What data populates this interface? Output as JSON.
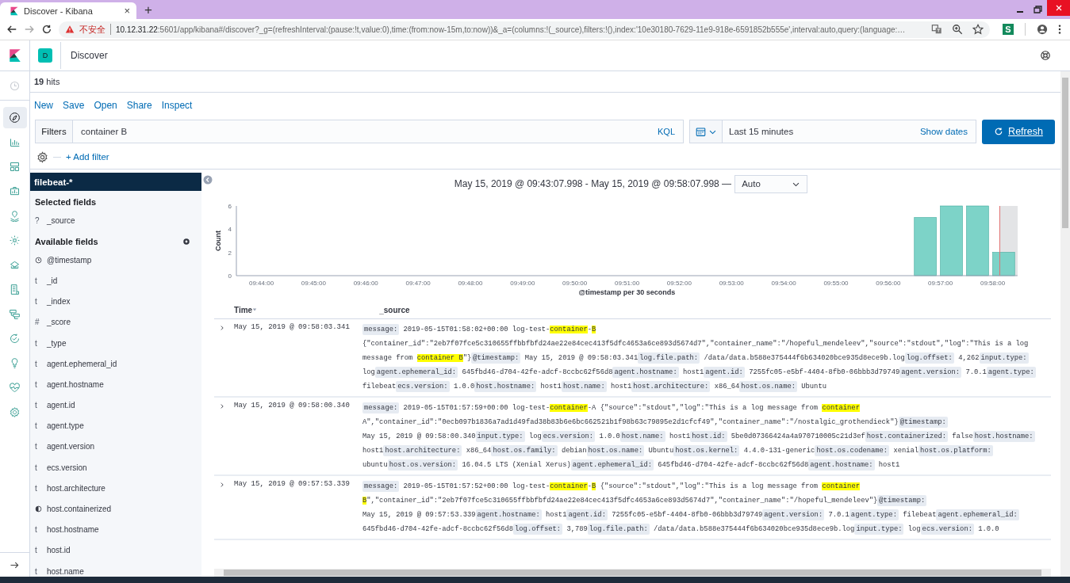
{
  "browser": {
    "tab_title": "Discover - Kibana",
    "tab_close": "×",
    "new_tab": "+",
    "security_label": "不安全",
    "url_host": "10.12.31.22",
    "url_rest": ":5601/app/kibana#/discover?_g=(refreshInterval:(pause:!t,value:0),time:(from:now-15m,to:now))&_a=(columns:!(_source),filters:!(),index:'10e30180-7629-11e9-918e-6591852b555e',interval:auto,query:(language:…",
    "extension_label": "S"
  },
  "header": {
    "space": "D",
    "breadcrumb": "Discover"
  },
  "nav_items": [
    {
      "selected": true
    },
    {
      "selected": false
    },
    {
      "selected": false
    },
    {
      "selected": false
    },
    {
      "selected": false
    },
    {
      "selected": false
    },
    {
      "selected": false
    },
    {
      "selected": false
    },
    {
      "selected": false
    },
    {
      "selected": false
    },
    {
      "selected": false
    },
    {
      "selected": false
    },
    {
      "selected": false
    }
  ],
  "hits": "**19** hits",
  "menu": [
    "New",
    "Save",
    "Open",
    "Share",
    "Inspect"
  ],
  "query": {
    "label": "Filters",
    "value": "container B",
    "language": "KQL",
    "time_range": "Last 15 minutes",
    "show_dates": "Show dates",
    "refresh": "Refresh",
    "add_filter": "+ Add filter"
  },
  "sidebar": {
    "index": "filebeat-*",
    "selected_title": "Selected fields",
    "selected": [
      {
        "kind": "unknown",
        "type_label": "?",
        "name": "_source"
      }
    ],
    "available_title": "Available fields",
    "available": [
      {
        "kind": "date",
        "name": "@timestamp"
      },
      {
        "kind": "text",
        "type_label": "t",
        "name": "_id"
      },
      {
        "kind": "text",
        "type_label": "t",
        "name": "_index"
      },
      {
        "kind": "text",
        "type_label": "#",
        "name": "_score"
      },
      {
        "kind": "text",
        "type_label": "t",
        "name": "_type"
      },
      {
        "kind": "text",
        "type_label": "t",
        "name": "agent.ephemeral_id"
      },
      {
        "kind": "text",
        "type_label": "t",
        "name": "agent.hostname"
      },
      {
        "kind": "text",
        "type_label": "t",
        "name": "agent.id"
      },
      {
        "kind": "text",
        "type_label": "t",
        "name": "agent.type"
      },
      {
        "kind": "text",
        "type_label": "t",
        "name": "agent.version"
      },
      {
        "kind": "text",
        "type_label": "t",
        "name": "ecs.version"
      },
      {
        "kind": "text",
        "type_label": "t",
        "name": "host.architecture"
      },
      {
        "kind": "boolean",
        "name": "host.containerized"
      },
      {
        "kind": "text",
        "type_label": "t",
        "name": "host.hostname"
      },
      {
        "kind": "text",
        "type_label": "t",
        "name": "host.id"
      },
      {
        "kind": "text",
        "type_label": "t",
        "name": "host.name"
      }
    ]
  },
  "chart": {
    "range": "May 15, 2019 @ 09:43:07.998 - May 15, 2019 @ 09:58:07.998 —",
    "interval": "Auto",
    "chart_data": {
      "type": "bar",
      "xlabel": "@timestamp per 30 seconds",
      "ylabel": "Count",
      "categories": [
        null,
        null,
        "09:44:00",
        null,
        "09:45:00",
        null,
        "09:46:00",
        null,
        "09:47:00",
        null,
        "09:48:00",
        null,
        "09:49:00",
        null,
        "09:50:00",
        null,
        "09:51:00",
        null,
        "09:52:00",
        null,
        "09:53:00",
        null,
        "09:54:00",
        null,
        "09:55:00",
        null,
        "09:56:00",
        null,
        "09:57:00",
        null,
        "09:58:00"
      ],
      "values": [
        0,
        0,
        0,
        0,
        0,
        0,
        0,
        0,
        0,
        0,
        0,
        0,
        0,
        0,
        0,
        0,
        0,
        0,
        0,
        0,
        0,
        0,
        0,
        0,
        0,
        0,
        0,
        5,
        6,
        6,
        2
      ],
      "ylim": [
        0,
        6
      ],
      "yticks": [
        0,
        2,
        4,
        6
      ]
    }
  },
  "table": {
    "columns": [
      "Time",
      "_source"
    ],
    "rows": [
      {
        "expanded": false,
        "time": "May 15, 2019 @ 09:58:03.341",
        "fields": [
          {
            "key": "message:",
            "value": [
              "2019-05-15T01:58:02+00:00 log-test-",
              "container",
              "-",
              "B",
              " {\"container_id\":\"2eb7f07fce5c310655ffbbfbfd24ae22e84cec413f5dfc4653a6ce893d5674d7\",\"container_name\":\"/hopeful_mendeleev\",\"source\":\"stdout\",\"log\":\"This is a log message from ",
              "container B",
              "\"}"
            ]
          },
          {
            "key": "@timestamp:",
            "value": "May 15, 2019 @ 09:58:03.341"
          },
          {
            "key": "log.file.path:",
            "value": "/data/data.b588e375444f6b634020bce935d8ece9b.log"
          },
          {
            "key": "log.offset:",
            "value": "4,262"
          },
          {
            "key": "input.type:",
            "value": "log"
          },
          {
            "key": "agent.ephemeral_id:",
            "value": "645fbd46-d704-42fe-adcf-8ccbc62f56d8"
          },
          {
            "key": "agent.hostname:",
            "value": "host1"
          },
          {
            "key": "agent.id:",
            "value": "7255fc05-e5bf-4404-8fb0-06bbb3d79749"
          },
          {
            "key": "agent.version:",
            "value": "7.0.1"
          },
          {
            "key": "agent.type:",
            "value": "filebeat"
          },
          {
            "key": "ecs.version:",
            "value": "1.0.0"
          },
          {
            "key": "host.hostname:",
            "value": "host1"
          },
          {
            "key": "host.name:",
            "value": "host1"
          },
          {
            "key": "host.architecture:",
            "value": "x86_64"
          },
          {
            "key": "host.os.name:",
            "value": "Ubuntu"
          }
        ]
      },
      {
        "expanded": false,
        "time": "May 15, 2019 @ 09:58:00.340",
        "fields": [
          {
            "key": "message:",
            "value": [
              "2019-05-15T01:57:59+00:00 log-test-",
              "container",
              "-A {\"source\":\"stdout\",\"log\":\"This is a log message from ",
              "container",
              " A\",\"container_id\":\"0ecb097b1836a7ad1d49fad38b83b6e6bc662521b1f98b63c79895e2d1cfcf49\",\"container_name\":\"/nostalgic_grothendieck\"}"
            ]
          },
          {
            "key": "@timestamp:",
            "value": "May 15, 2019 @ 09:58:00.340"
          },
          {
            "key": "input.type:",
            "value": "log"
          },
          {
            "key": "ecs.version:",
            "value": "1.0.0"
          },
          {
            "key": "host.name:",
            "value": "host1"
          },
          {
            "key": "host.id:",
            "value": "5be0d07366424a4a970710005c21d3ef"
          },
          {
            "key": "host.containerized:",
            "value": "false"
          },
          {
            "key": "host.hostname:",
            "value": "host1"
          },
          {
            "key": "host.architecture:",
            "value": "x86_64"
          },
          {
            "key": "host.os.family:",
            "value": "debian"
          },
          {
            "key": "host.os.name:",
            "value": "Ubuntu"
          },
          {
            "key": "host.os.kernel:",
            "value": "4.4.0-131-generic"
          },
          {
            "key": "host.os.codename:",
            "value": "xenial"
          },
          {
            "key": "host.os.platform:",
            "value": "ubuntu"
          },
          {
            "key": "host.os.version:",
            "value": "16.04.5 LTS (Xenial Xerus)"
          },
          {
            "key": "agent.ephemeral_id:",
            "value": "645fbd46-d704-42fe-adcf-8ccbc62f56d8"
          },
          {
            "key": "agent.hostname:",
            "value": "host1"
          }
        ]
      },
      {
        "expanded": false,
        "time": "May 15, 2019 @ 09:57:53.339",
        "fields": [
          {
            "key": "message:",
            "value": [
              "2019-05-15T01:57:52+00:00 log-test-",
              "container",
              "-",
              "B",
              " {\"source\":\"stdout\",\"log\":\"This is a log message from ",
              "container B",
              "\",\"container_id\":\"2eb7f07fce5c310655ffbbfbfd24ae22e84cec413f5dfc4653a6ce893d5674d7\",\"container_name\":\"/hopeful_mendeleev\"}"
            ]
          },
          {
            "key": "@timestamp:",
            "value": "May 15, 2019 @ 09:57:53.339"
          },
          {
            "key": "agent.hostname:",
            "value": "host1"
          },
          {
            "key": "agent.id:",
            "value": "7255fc05-e5bf-4404-8fb0-06bbb3d79749"
          },
          {
            "key": "agent.version:",
            "value": "7.0.1"
          },
          {
            "key": "agent.type:",
            "value": "filebeat"
          },
          {
            "key": "agent.ephemeral_id:",
            "value": "645fbd46-d704-42fe-adcf-8ccbc62f56d8"
          },
          {
            "key": "log.offset:",
            "value": "3,789"
          },
          {
            "key": "log.file.path:",
            "value": "/data/data.b588e375444f6b634020bce935d8ece9b.log"
          },
          {
            "key": "input.type:",
            "value": "log"
          },
          {
            "key": "ecs.version:",
            "value": "1.0.0"
          }
        ]
      }
    ]
  }
}
